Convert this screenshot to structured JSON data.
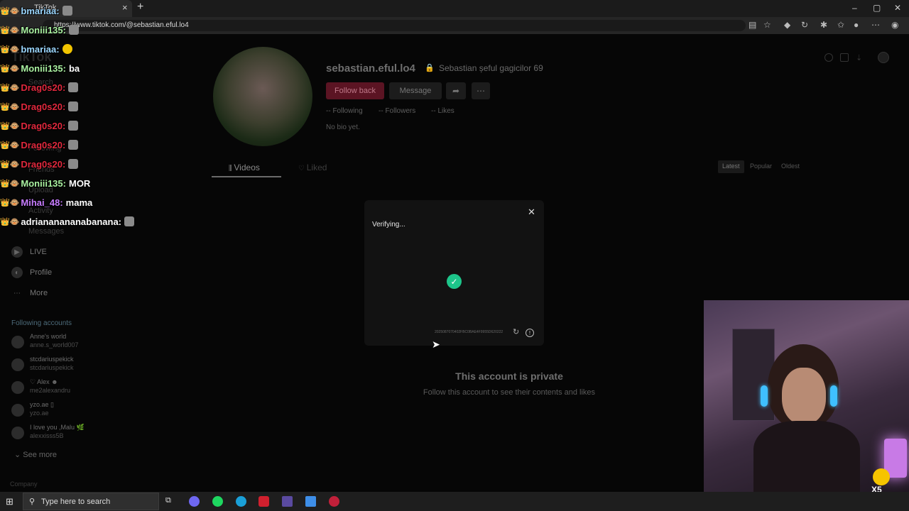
{
  "browser": {
    "tab_title": "TikTok",
    "new_tab": "+",
    "tab_close": "×",
    "url": "https://www.tiktok.com/@sebastian.eful.lo4",
    "window_controls": [
      "–",
      "▢",
      "✕"
    ]
  },
  "sidebar": {
    "logo": "TikTok",
    "faint_items": [
      "Search",
      "Following",
      "Friends",
      "Upload",
      "Activity",
      "Messages"
    ],
    "items": [
      {
        "label": "LIVE",
        "icon": "live-icon"
      },
      {
        "label": "Profile",
        "icon": "profile-icon"
      },
      {
        "label": "More",
        "icon": "more-icon"
      }
    ],
    "following_header": "Following accounts",
    "accounts": [
      {
        "name": "Anne's world",
        "handle": "anne.s_world007"
      },
      {
        "name": "stcdariuspekick",
        "handle": "stcdariuspekick"
      },
      {
        "name": "♡ Alex ☻",
        "handle": "me2alexandru"
      },
      {
        "name": "yzo.ae ▯",
        "handle": "yzo.ae"
      },
      {
        "name": "I love you ,Malu 🌿",
        "handle": "alexxisss5B"
      }
    ],
    "see_more": "See more",
    "company": "Company"
  },
  "profile": {
    "username": "sebastian.eful.lo4",
    "display_name": "Sebastian șeful gagicilor 69",
    "follow_back": "Follow back",
    "message": "Message",
    "stats": {
      "following": "-- Following",
      "followers": "-- Followers",
      "likes": "-- Likes"
    },
    "bio": "No bio yet.",
    "tabs": {
      "videos": "Videos",
      "liked": "Liked"
    },
    "sort": [
      "Latest",
      "Popular",
      "Oldest"
    ],
    "private_title": "This account is private",
    "private_sub": "Follow this account to see their contents and likes"
  },
  "captcha": {
    "title": "Verifying...",
    "id": "2025087070402FBC0BAE4F9955D620222"
  },
  "chat": [
    {
      "user": "bmariaa:",
      "color": "#9bd7ff",
      "text": "",
      "emote": "gray"
    },
    {
      "user": "Moniii135:",
      "color": "#a9f0a0",
      "text": "",
      "emote": "gray"
    },
    {
      "user": "bmariaa:",
      "color": "#9bd7ff",
      "text": "",
      "emote": "yellow"
    },
    {
      "user": "Moniii135:",
      "color": "#a9f0a0",
      "text": "ba",
      "emote": ""
    },
    {
      "user": "Drag0s20:",
      "color": "#e0283d",
      "text": "",
      "emote": "gray"
    },
    {
      "user": "Drag0s20:",
      "color": "#e0283d",
      "text": "",
      "emote": "gray"
    },
    {
      "user": "Drag0s20:",
      "color": "#e0283d",
      "text": "",
      "emote": "gray"
    },
    {
      "user": "Drag0s20:",
      "color": "#e0283d",
      "text": "",
      "emote": "gray"
    },
    {
      "user": "Drag0s20:",
      "color": "#e0283d",
      "text": "",
      "emote": "gray"
    },
    {
      "user": "Moniii135:",
      "color": "#a9f0a0",
      "text": "MOR",
      "emote": ""
    },
    {
      "user": "Mihai_48:",
      "color": "#c77dff",
      "text": "mama",
      "emote": ""
    },
    {
      "user": "adriananananabanana:",
      "color": "#ffffff",
      "text": "",
      "emote": "gray"
    }
  ],
  "webcam": {
    "gift_count": "X5"
  },
  "taskbar": {
    "search_placeholder": "Type here to search"
  }
}
